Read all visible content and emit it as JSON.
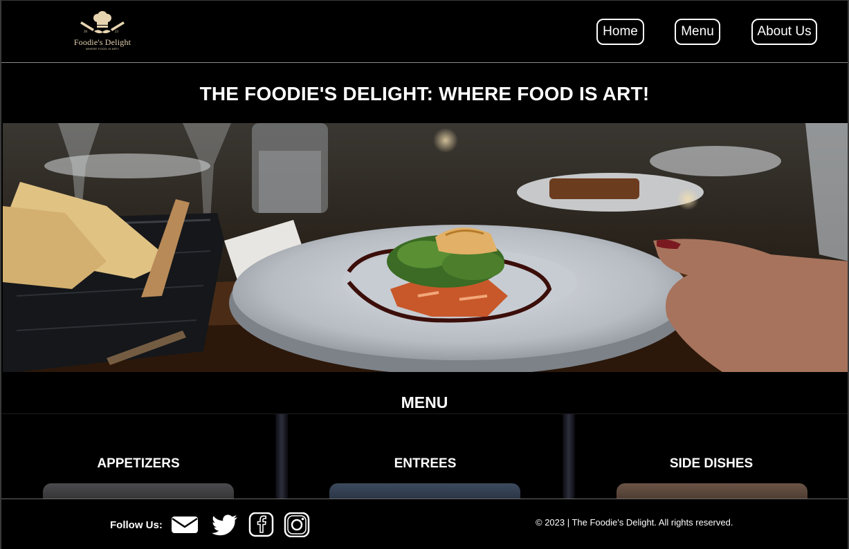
{
  "header": {
    "logo": {
      "name": "Foodie's Delight",
      "tagline": "WHERE FOOD IS ART!",
      "year_left": "20",
      "year_right": "23"
    },
    "nav": [
      {
        "label": "Home"
      },
      {
        "label": "Menu"
      },
      {
        "label": "About Us"
      }
    ]
  },
  "hero": {
    "title": "THE FOODIE'S DELIGHT: WHERE FOOD IS ART!",
    "image": "plated-dish-on-restaurant-table-photo"
  },
  "menu": {
    "title": "MENU",
    "categories": [
      {
        "title": "APPETIZERS"
      },
      {
        "title": "ENTREES"
      },
      {
        "title": "SIDE DISHES"
      }
    ]
  },
  "footer": {
    "follow_label": "Follow Us:",
    "social_icons": [
      "mail-icon",
      "twitter-icon",
      "facebook-icon",
      "instagram-icon"
    ],
    "copyright": "© 2023 | The Foodie's Delight. All rights reserved."
  },
  "colors": {
    "background": "#000000",
    "text": "#ffffff",
    "logo_gold": "#e6d3b0"
  }
}
